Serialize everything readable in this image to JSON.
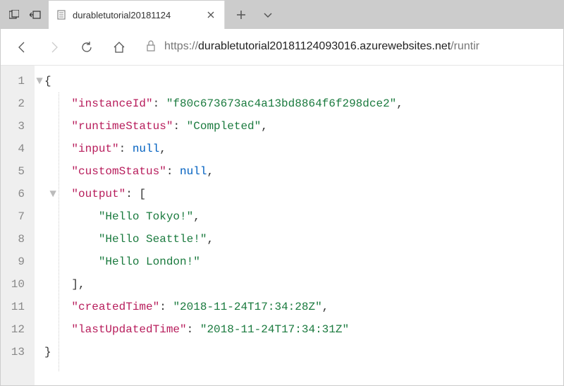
{
  "window": {
    "tab_title": "durabletutorial20181124"
  },
  "url": {
    "scheme": "https://",
    "host": "durabletutorial20181124093016.azurewebsites.net",
    "path": "/runtir"
  },
  "json": {
    "k_instanceId": "\"instanceId\"",
    "v_instanceId": "\"f80c673673ac4a13bd8864f6f298dce2\"",
    "k_runtimeStatus": "\"runtimeStatus\"",
    "v_runtimeStatus": "\"Completed\"",
    "k_input": "\"input\"",
    "v_input": "null",
    "k_customStatus": "\"customStatus\"",
    "v_customStatus": "null",
    "k_output": "\"output\"",
    "v_output0": "\"Hello Tokyo!\"",
    "v_output1": "\"Hello Seattle!\"",
    "v_output2": "\"Hello London!\"",
    "k_createdTime": "\"createdTime\"",
    "v_createdTime": "\"2018-11-24T17:34:28Z\"",
    "k_lastUpdatedTime": "\"lastUpdatedTime\"",
    "v_lastUpdatedTime": "\"2018-11-24T17:34:31Z\""
  },
  "line_numbers": [
    "1",
    "2",
    "3",
    "4",
    "5",
    "6",
    "7",
    "8",
    "9",
    "10",
    "11",
    "12",
    "13"
  ]
}
